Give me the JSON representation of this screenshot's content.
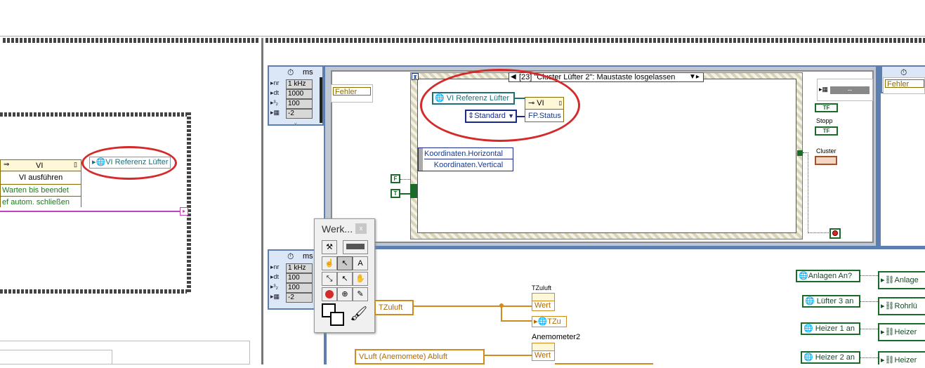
{
  "left_frame": {
    "invoke": {
      "header": "VI",
      "method": "VI ausführen",
      "param1": "Warten bis beendet",
      "param2": "ef autom. schließen"
    },
    "ref_label": "VI Referenz Lüfter"
  },
  "timer_top": {
    "unit": "ms",
    "rows": [
      {
        "label": "nr",
        "value": "1 kHz"
      },
      {
        "label": "dt",
        "value": "1000"
      },
      {
        "label": "t",
        "value": "100"
      },
      {
        "label": "",
        "value": "-2"
      }
    ]
  },
  "timer_bottom": {
    "unit": "ms",
    "rows": [
      {
        "label": "nr",
        "value": "1 kHz"
      },
      {
        "label": "dt",
        "value": "100"
      },
      {
        "label": "t",
        "value": "100"
      },
      {
        "label": "",
        "value": "-2"
      }
    ]
  },
  "error_in": "Fehler",
  "error_out": "Fehler",
  "event_case": {
    "selector": "[23] \"Cluster Lüfter 2\": Maustaste losgelassen",
    "hourglass": "⧗",
    "ref": "VI Referenz Lüfter",
    "prop_header": "VI",
    "prop_item": "FP.Status",
    "enum": "Standard",
    "coord_h": "Koordinaten.Horizontal",
    "coord_v": "Koordinaten.Vertical"
  },
  "consts": {
    "f": "F",
    "t": "T"
  },
  "right_panel": {
    "tf1": "TF",
    "stopp": "Stopp",
    "tf2": "TF",
    "cluster": "Cluster",
    "dash": "--"
  },
  "tools": {
    "title": "Werk...",
    "close": "x"
  },
  "bottom": {
    "tzuluft_ctrl": "TZuluft",
    "tzuluft_label": "TZuluft",
    "wert1": "Wert",
    "tzu": "TZu",
    "anemometer": "Anemometer2",
    "wert2": "Wert",
    "vluft": "VLuft (Anemomete) Abluft",
    "anlagen": "Anlagen An?",
    "anlage_r": "Anlage",
    "luefter3": "Lüfter 3 an",
    "rohr": "Rohrlü",
    "heizer1": "Heizer 1 an",
    "heizer1_r": "Heizer",
    "heizer2": "Heizer 2 an",
    "heizer2_r": "Heizer"
  }
}
